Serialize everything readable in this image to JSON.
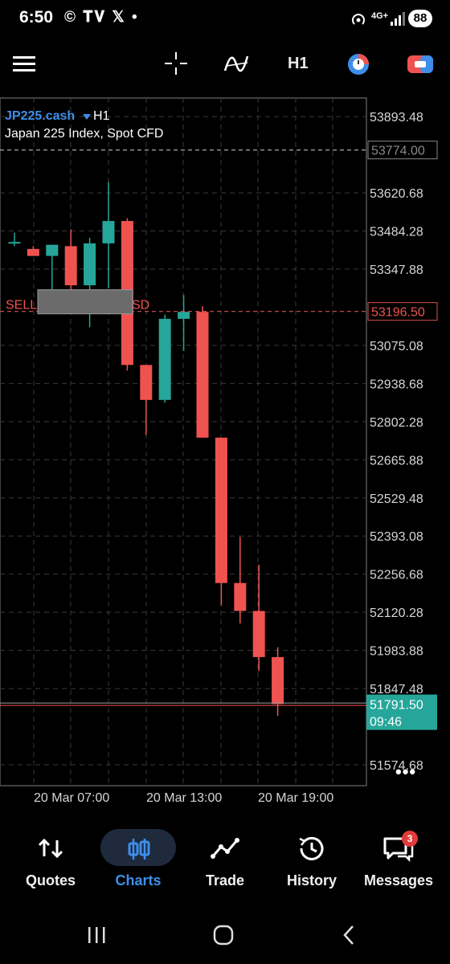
{
  "status_bar": {
    "time": "6:50",
    "notif_icons": "© 𝐓𝐕 𝕏 •",
    "network": "4G+",
    "battery": "88"
  },
  "toolbar": {
    "timeframe": "H1"
  },
  "chart_data": {
    "type": "candlestick",
    "symbol": "JP225.cash",
    "timeframe": "H1",
    "description": "Japan 225 Index, Spot CFD",
    "ylim": [
      51500,
      53960
    ],
    "price_ticks": [
      "53893.48",
      "53620.68",
      "53484.28",
      "53347.88",
      "53075.08",
      "52938.68",
      "52802.28",
      "52665.88",
      "52529.48",
      "52393.08",
      "52256.68",
      "52120.28",
      "51983.88",
      "51847.48",
      "51574.68"
    ],
    "time_labels": [
      "20 Mar 07:00",
      "20 Mar 13:00",
      "20 Mar 19:00"
    ],
    "levels": {
      "top_dashed": "53774.00",
      "sell_level": "53196.50",
      "sell_label_left": "SELL",
      "sell_label_right": "SD",
      "current_price": "51791.50",
      "countdown": "09:46"
    },
    "candles": [
      {
        "o": 53445,
        "h": 53478,
        "l": 53430,
        "c": 53445
      },
      {
        "o": 53420,
        "h": 53430,
        "l": 53395,
        "c": 53395
      },
      {
        "o": 53395,
        "h": 53435,
        "l": 53250,
        "c": 53435
      },
      {
        "o": 53430,
        "h": 53490,
        "l": 53250,
        "c": 53290
      },
      {
        "o": 53290,
        "h": 53460,
        "l": 53140,
        "c": 53440
      },
      {
        "o": 53440,
        "h": 53660,
        "l": 53280,
        "c": 53520
      },
      {
        "o": 53520,
        "h": 53530,
        "l": 52985,
        "c": 53005
      },
      {
        "o": 53005,
        "h": 53005,
        "l": 52755,
        "c": 52880
      },
      {
        "o": 52880,
        "h": 53185,
        "l": 52870,
        "c": 53170
      },
      {
        "o": 53170,
        "h": 53255,
        "l": 53055,
        "c": 53195
      },
      {
        "o": 53195,
        "h": 53215,
        "l": 52745,
        "c": 52745
      },
      {
        "o": 52745,
        "h": 52745,
        "l": 52145,
        "c": 52225
      },
      {
        "o": 52225,
        "h": 52390,
        "l": 52080,
        "c": 52125
      },
      {
        "o": 52125,
        "h": 52290,
        "l": 51910,
        "c": 51960
      },
      {
        "o": 51960,
        "h": 51995,
        "l": 51750,
        "c": 51792
      }
    ]
  },
  "more_menu": "•••",
  "bottom_nav": {
    "items": [
      {
        "label": "Quotes"
      },
      {
        "label": "Charts"
      },
      {
        "label": "Trade"
      },
      {
        "label": "History"
      },
      {
        "label": "Messages"
      }
    ],
    "messages_badge": "3"
  },
  "colors": {
    "bull": "#26a69a",
    "bear": "#ef5350",
    "accent": "#3d8fea",
    "grid": "#3a3a3a"
  }
}
